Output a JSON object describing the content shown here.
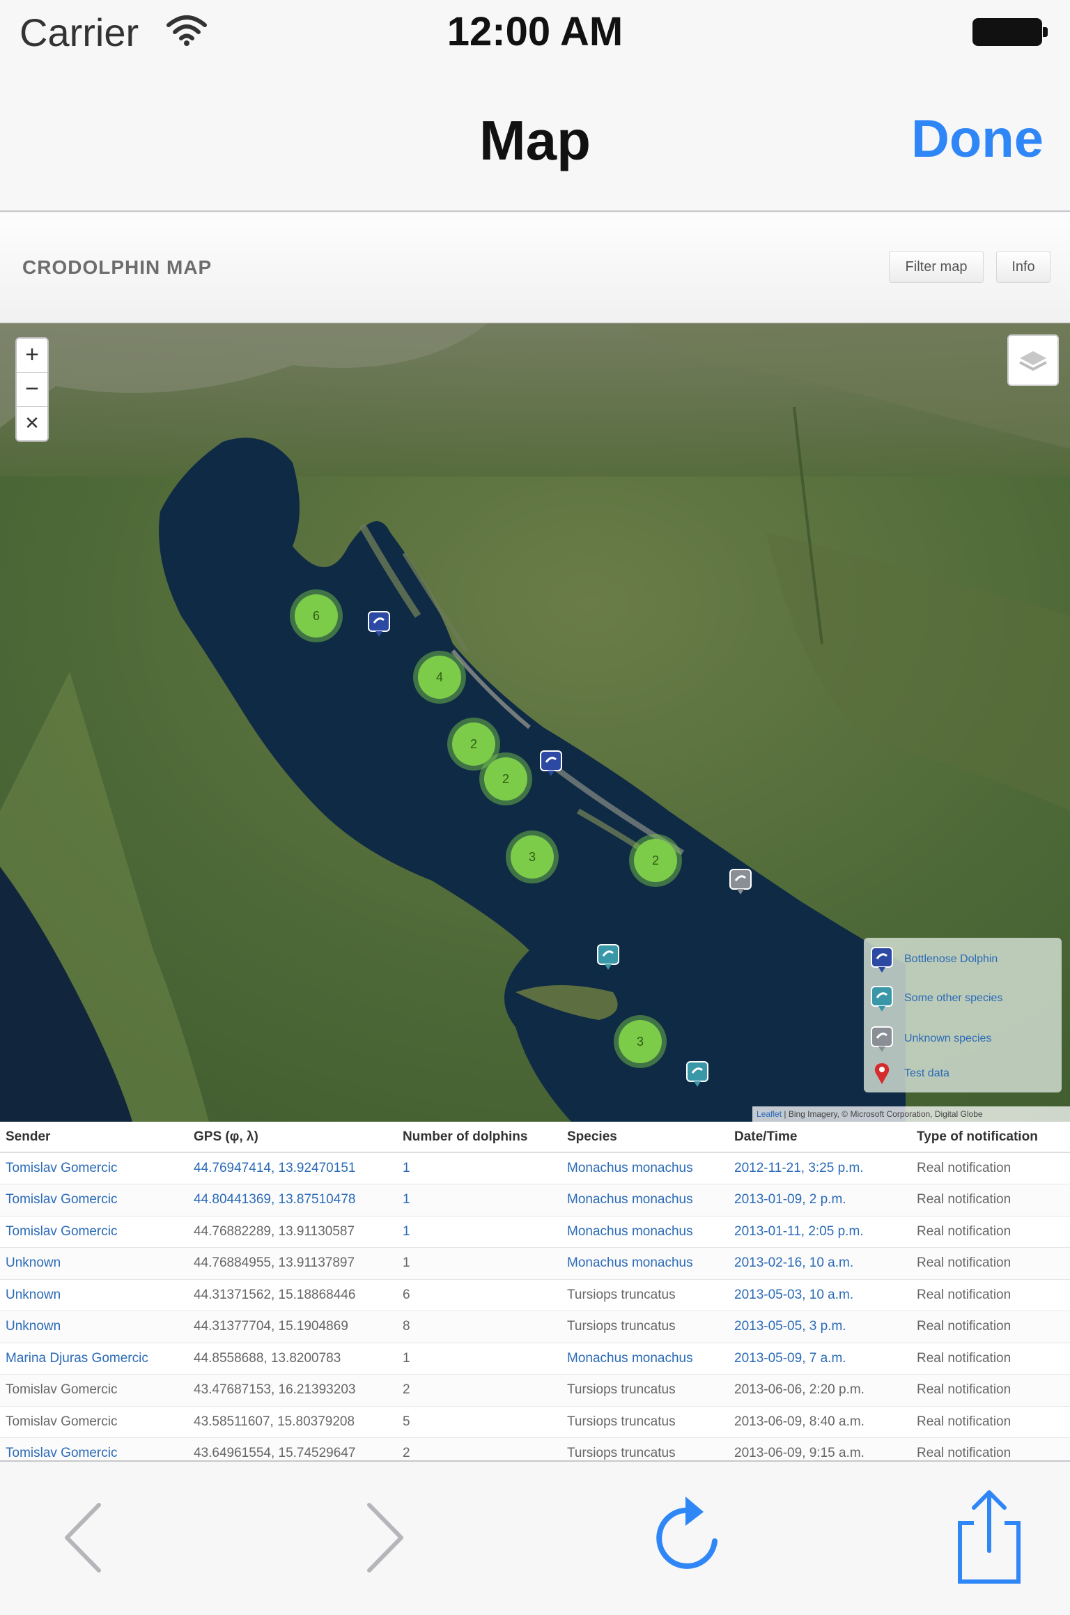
{
  "status_bar": {
    "carrier": "Carrier",
    "time": "12:00 AM"
  },
  "nav": {
    "title": "Map",
    "done_label": "Done"
  },
  "page": {
    "brand": "CRODOLPHIN MAP",
    "filter_button": "Filter map",
    "info_button": "Info"
  },
  "map": {
    "zoom_in": "+",
    "zoom_out": "−",
    "fullscreen": "✕",
    "clusters": [
      "6",
      "4",
      "2",
      "2",
      "3",
      "2",
      "3"
    ],
    "legend": [
      {
        "label": "Bottlenose Dolphin",
        "icon": "blue-dolphin-pin-icon",
        "color": "#2c4aa3"
      },
      {
        "label": "Some other species",
        "icon": "teal-dolphin-pin-icon",
        "color": "#3a97a8"
      },
      {
        "label": "Unknown species",
        "icon": "gray-dolphin-pin-icon",
        "color": "#8a8f96"
      },
      {
        "label": "Test data",
        "icon": "red-location-pin-icon",
        "color": "#d62b2b"
      }
    ],
    "attribution_link": "Leaflet",
    "attribution_text": " | Bing Imagery, © Microsoft Corporation, Digital Globe"
  },
  "table": {
    "headers": [
      "Sender",
      "GPS (φ, λ)",
      "Number of dolphins",
      "Species",
      "Date/Time",
      "Type of notification"
    ],
    "rows": [
      [
        "Tomislav Gomercic",
        "44.76947414, 13.92470151",
        "1",
        "Monachus monachus",
        "2012-11-21, 3:25 p.m.",
        "Real notification"
      ],
      [
        "Tomislav Gomercic",
        "44.80441369, 13.87510478",
        "1",
        "Monachus monachus",
        "2013-01-09, 2 p.m.",
        "Real notification"
      ],
      [
        "Tomislav Gomercic",
        "44.76882289, 13.91130587",
        "1",
        "Monachus monachus",
        "2013-01-11, 2:05 p.m.",
        "Real notification"
      ],
      [
        "Unknown",
        "44.76884955, 13.91137897",
        "1",
        "Monachus monachus",
        "2013-02-16, 10 a.m.",
        "Real notification"
      ],
      [
        "Unknown",
        "44.31371562, 15.18868446",
        "6",
        "Tursiops truncatus",
        "2013-05-03, 10 a.m.",
        "Real notification"
      ],
      [
        "Unknown",
        "44.31377704, 15.1904869",
        "8",
        "Tursiops truncatus",
        "2013-05-05, 3 p.m.",
        "Real notification"
      ],
      [
        "Marina Djuras Gomercic",
        "44.8558688, 13.8200783",
        "1",
        "Monachus monachus",
        "2013-05-09, 7 a.m.",
        "Real notification"
      ],
      [
        "Tomislav Gomercic",
        "43.47687153, 16.21393203",
        "2",
        "Tursiops truncatus",
        "2013-06-06, 2:20 p.m.",
        "Real notification"
      ],
      [
        "Tomislav Gomercic",
        "43.58511607, 15.80379208",
        "5",
        "Tursiops truncatus",
        "2013-06-09, 8:40 a.m.",
        "Real notification"
      ],
      [
        "Tomislav Gomercic",
        "43.64961554, 15.74529647",
        "2",
        "Tursiops truncatus",
        "2013-06-09, 9:15 a.m.",
        "Real notification"
      ]
    ]
  },
  "toolbar": {
    "back_icon": "chevron-left-icon",
    "forward_icon": "chevron-right-icon",
    "reload_icon": "reload-icon",
    "share_icon": "share-icon"
  },
  "colors": {
    "accent": "#2f86f6",
    "cluster": "#7ccc4a",
    "sea": "#0f2a44",
    "link": "#2a6ab7"
  }
}
